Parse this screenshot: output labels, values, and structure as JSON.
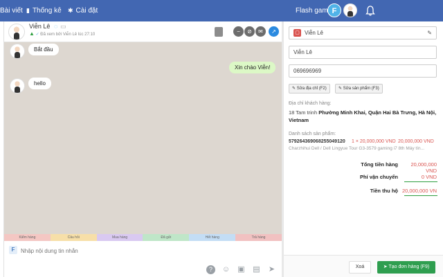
{
  "topbar": {
    "nav": [
      {
        "label": "Bài viết",
        "icon": "document-icon"
      },
      {
        "label": "Thống kê",
        "icon": "bar-chart-icon"
      },
      {
        "label": "Cài đặt",
        "icon": "gear-icon"
      }
    ],
    "flash_label": "Flash game",
    "avatar_letter": "F",
    "bg_color": "#4267b2"
  },
  "chat": {
    "name": "Viễn Lê",
    "seen_text": "Đã xem bởi Viễn Lê lúc 27:10",
    "messages": [
      {
        "text": "Bắt đầu",
        "direction": "in"
      },
      {
        "text": "Xin chào Viễn!",
        "direction": "out"
      },
      {
        "text": "hello",
        "direction": "in"
      }
    ],
    "tags": [
      {
        "label": "Kiểm hàng",
        "color": "#f4c7c3"
      },
      {
        "label": "Câu hỏi",
        "color": "#f7dfa8"
      },
      {
        "label": "Mua hàng",
        "color": "#d9c9f1"
      },
      {
        "label": "Đã gửi",
        "color": "#bfe6c8"
      },
      {
        "label": "Hết hàng",
        "color": "#c3ddf5"
      },
      {
        "label": "Trả hàng",
        "color": "#f1c1c1"
      }
    ],
    "composer_placeholder": "Nhập nội dung tin nhắn",
    "composer_chip": "F"
  },
  "order": {
    "customer_name": "Viễn Lê",
    "name_field": "Viễn Lê",
    "phone_field": "069696969",
    "btn_edit_address": "Sửa địa chỉ (F2)",
    "btn_edit_product": "Sửa sản phẩm (F3)",
    "address_label": "Địa chỉ khách hàng:",
    "address_prefix": "18 Tam trinh",
    "address_bold": "Phường Minh Khai, Quận Hai Bà Trưng, Hà Nội, Vietnam",
    "products_label": "Danh sách sản phẩm:",
    "product_code": "5792643690682550491­20",
    "product_qty_price": "1 × 20,000,000 VND",
    "product_total": "20,000,000 VND",
    "product_desc": "Charzhihui Dell / Dell Lingyue Tour G3-3579 gaming i7 8th  Máy tín...",
    "total_label": "Tổng tiền hàng",
    "total_value": "20,000,000 VND",
    "shipping_label": "Phí vận chuyển",
    "shipping_value": "0 VND",
    "collect_label": "Tiền thu hộ",
    "collect_value": "20,000,000 VN",
    "cancel_label": "Xoá",
    "create_label": "Tạo đơn hàng (F9)"
  }
}
